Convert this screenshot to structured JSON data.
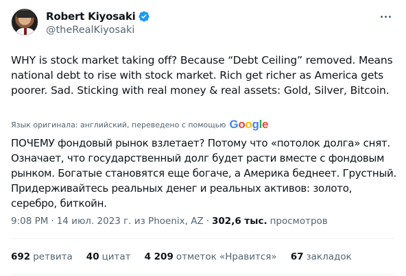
{
  "author": {
    "display_name": "Robert Kiyosaki",
    "handle": "@theRealKiyosaki",
    "verified": true
  },
  "tweet": {
    "text": "WHY is stock market taking off?  Because “Debt Ceiling” removed. Means national debt to rise with stock market. Rich get richer as America gets poorer. Sad. Sticking with real money & real assets: Gold, Silver, Bitcoin.",
    "translation_note": "Язык оригинала: английский, переведено с помощью",
    "translation_provider": "Google",
    "translated_text": "ПОЧЕМУ фондовый рынок взлетает? Потому что «потолок долга» снят. Означает, что государственный долг будет расти вместе с фондовым рынком. Богатые становятся еще богаче, а Америка беднеет. Грустный. Придерживайтесь реальных денег и реальных активов: золото, серебро, биткойн."
  },
  "meta": {
    "time": "9:08 PM",
    "date": "14 июл. 2023 г. из Phoenix, AZ",
    "views_count": "302,6 тыс.",
    "views_label": "просмотров"
  },
  "stats": [
    {
      "count": "692",
      "label": "ретвита"
    },
    {
      "count": "40",
      "label": "цитат"
    },
    {
      "count": "4 209",
      "label": "отметок «Нравится»"
    },
    {
      "count": "67",
      "label": "закладок"
    }
  ],
  "icons": {
    "verified": "verified-badge-icon",
    "more": "more-options-icon"
  },
  "colors": {
    "verified": "#1d9bf0",
    "secondary_text": "#536471",
    "google_blue": "#4285F4",
    "google_red": "#EA4335",
    "google_yellow": "#FBBC05",
    "google_green": "#34A853"
  }
}
